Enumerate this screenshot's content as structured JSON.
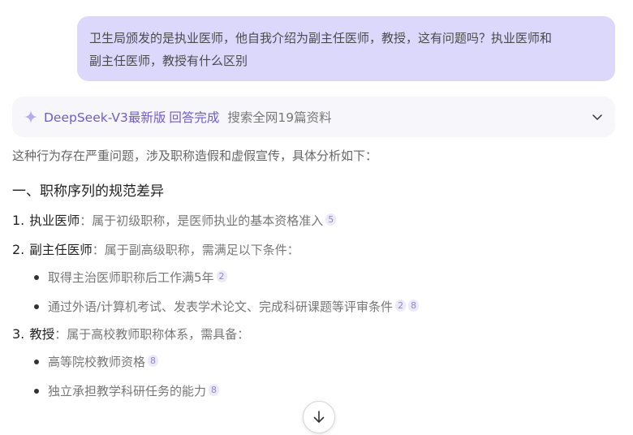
{
  "user_message": {
    "line1": "卫生局颁发的是执业医师，他自我介绍为副主任医师，教授，这有问题吗？执业医师和",
    "line2": "副主任医师，教授有什么区别"
  },
  "status": {
    "model": "DeepSeek-V3最新版",
    "state": "回答完成",
    "sources": "搜索全网19篇资料"
  },
  "answer": {
    "intro": "这种行为存在严重问题，涉及职称造假和虚假宣传，具体分析如下：",
    "heading": "一、职称序列的规范差异",
    "items": [
      {
        "num": "1.",
        "term": "执业医师",
        "desc": "：属于初级职称，是医师执业的基本资格准入",
        "cites": [
          "5"
        ],
        "bullets": []
      },
      {
        "num": "2.",
        "term": "副主任医师",
        "desc": "：属于副高级职称，需满足以下条件：",
        "cites": [],
        "bullets": [
          {
            "text": "取得主治医师职称后工作满5年",
            "cites": [
              "2"
            ]
          },
          {
            "text": "通过外语/计算机考试、发表学术论文、完成科研课题等评审条件",
            "cites": [
              "2",
              "8"
            ]
          }
        ]
      },
      {
        "num": "3.",
        "term": "教授",
        "desc": "：属于高校教师职称体系，需具备：",
        "cites": [],
        "bullets": [
          {
            "text": "高等院校教师资格",
            "cites": [
              "8"
            ]
          },
          {
            "text": "独立承担教学科研任务的能力",
            "cites": [
              "8"
            ]
          }
        ]
      }
    ]
  },
  "icons": {
    "status": "sparkle-icon",
    "expand": "chevron-down-icon",
    "scroll": "arrow-down-icon"
  },
  "colors": {
    "bubble": "#dcd8fb",
    "accent": "#6e5bd8",
    "status_bg": "#f7f7fb",
    "cite_bg": "#eceaf8"
  }
}
